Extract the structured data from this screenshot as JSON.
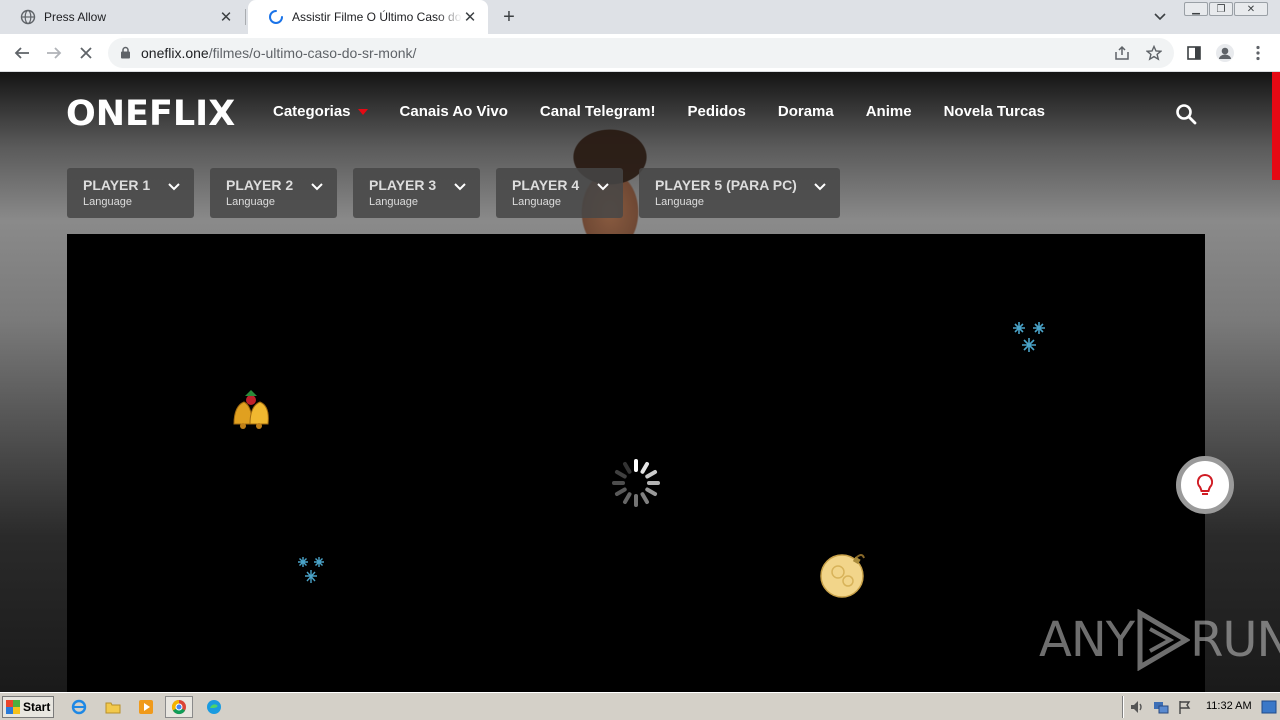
{
  "browser": {
    "tabs": [
      {
        "title": "Press Allow",
        "active": false
      },
      {
        "title": "Assistir Filme O Último Caso do Sr. Monk",
        "active": true
      }
    ],
    "url_host": "oneflix.one",
    "url_path": "/filmes/o-ultimo-caso-do-sr-monk/"
  },
  "site": {
    "logo": "ONEFLIX",
    "nav": [
      {
        "label": "Categorias",
        "has_caret": true
      },
      {
        "label": "Canais Ao Vivo"
      },
      {
        "label": "Canal Telegram!"
      },
      {
        "label": "Pedidos"
      },
      {
        "label": "Dorama"
      },
      {
        "label": "Anime"
      },
      {
        "label": "Novela Turcas"
      }
    ],
    "players": [
      {
        "name": "PLAYER 1",
        "sub": "Language"
      },
      {
        "name": "PLAYER 2",
        "sub": "Language"
      },
      {
        "name": "PLAYER 3",
        "sub": "Language"
      },
      {
        "name": "PLAYER 4",
        "sub": "Language"
      },
      {
        "name": "PLAYER 5 (PARA PC)",
        "sub": "Language"
      }
    ],
    "accent_color": "#e50914"
  },
  "watermark": {
    "left": "ANY",
    "right": "RUN"
  },
  "taskbar": {
    "start_label": "Start",
    "clock": "11:32 AM"
  }
}
